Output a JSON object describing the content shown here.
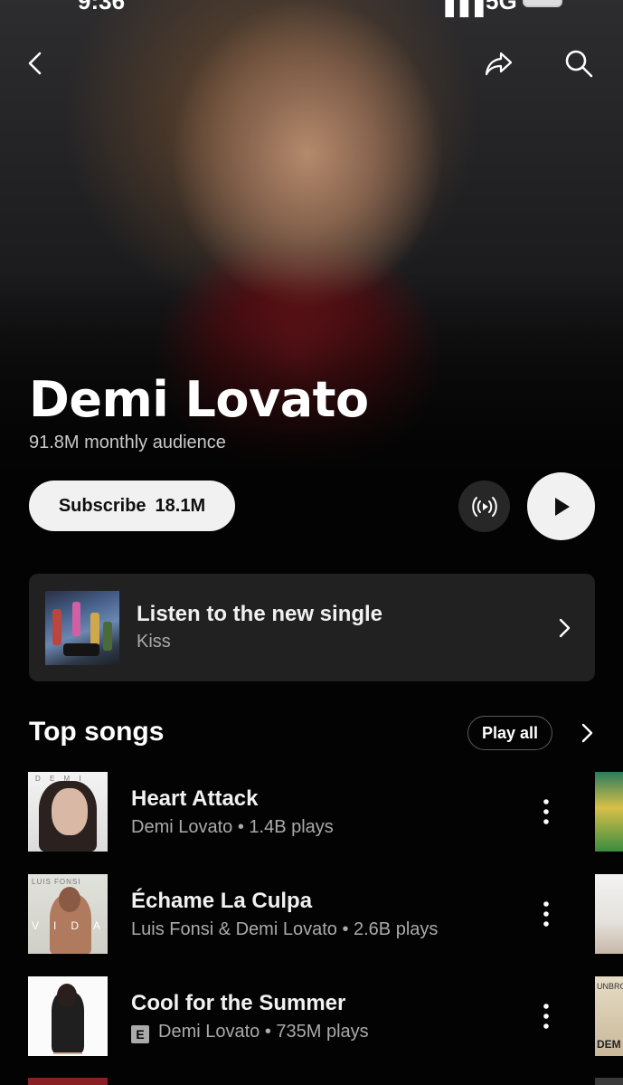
{
  "status_bar": {
    "time": "9:36",
    "network": "5G"
  },
  "nav": {
    "back_icon": "chevron-left-icon",
    "share_icon": "share-icon",
    "search_icon": "search-icon"
  },
  "artist": {
    "name": "Demi Lovato",
    "audience": "91.8M monthly audience"
  },
  "actions": {
    "subscribe_label": "Subscribe",
    "subscriber_count": "18.1M",
    "radio_icon": "radio-icon",
    "play_icon": "play-icon"
  },
  "new_single": {
    "title": "Listen to the new single",
    "subtitle": "Kiss"
  },
  "top_songs": {
    "title": "Top songs",
    "play_all_label": "Play all",
    "songs": [
      {
        "title": "Heart Attack",
        "meta": "Demi Lovato • 1.4B plays",
        "explicit": false,
        "thumb_text": "D E M I"
      },
      {
        "title": "Échame La Culpa",
        "meta": "Luis Fonsi & Demi Lovato • 2.6B plays",
        "explicit": false,
        "thumb_text": "LUIS FONSI",
        "thumb_text2": "VIDA"
      },
      {
        "title": "Cool for the Summer",
        "meta": "Demi Lovato • 735M plays",
        "explicit": true,
        "explicit_label": "E"
      }
    ],
    "next_column_texts": [
      "UNBROKEN",
      "DEM"
    ]
  },
  "colors": {
    "background": "#030303",
    "card": "#212121",
    "primary_text": "#f1f1f1",
    "secondary_text": "#aaaaaa",
    "button_light": "#f1f1f1",
    "button_dark": "#272727"
  }
}
